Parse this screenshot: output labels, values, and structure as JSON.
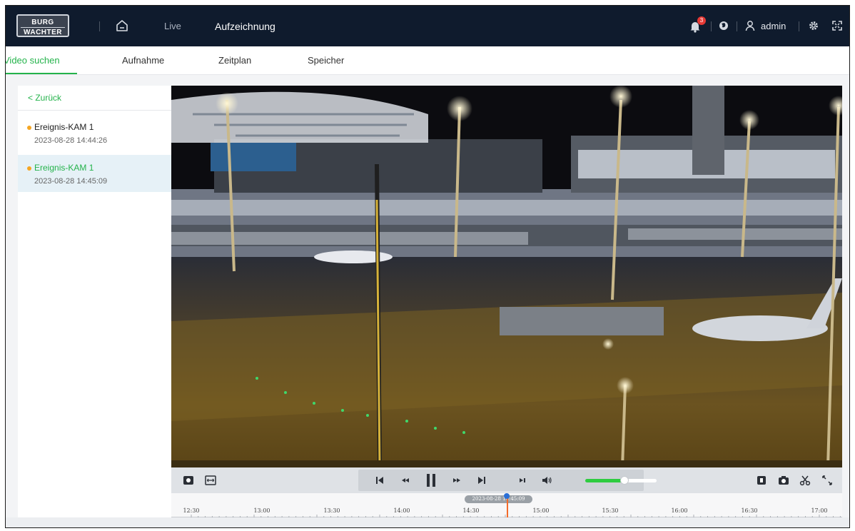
{
  "header": {
    "logo_line1": "BURG",
    "logo_line2": "WACHTER",
    "nav_live": "Live",
    "nav_recording": "Aufzeichnung",
    "notification_count": "3",
    "username": "admin"
  },
  "tabs": [
    {
      "label": "Video suchen",
      "active": true
    },
    {
      "label": "Aufnahme",
      "active": false
    },
    {
      "label": "Zeitplan",
      "active": false
    },
    {
      "label": "Speicher",
      "active": false
    }
  ],
  "sidebar": {
    "back_label": "< Zurück",
    "events": [
      {
        "name": "Ereignis-KAM 1",
        "time": "2023-08-28 14:44:26",
        "selected": false
      },
      {
        "name": "Ereignis-KAM 1",
        "time": "2023-08-28 14:45:09",
        "selected": true
      }
    ]
  },
  "player": {
    "state": "playing",
    "volume": 0.55
  },
  "timeline": {
    "labels": [
      "12:30",
      "13:00",
      "13:30",
      "14:00",
      "14:30",
      "15:00",
      "15:30",
      "16:00",
      "16:30",
      "17:00"
    ],
    "current_time": "2023-08-28 14:45:09"
  },
  "colors": {
    "accent": "#24b34b",
    "header_bg": "#0f1b2d",
    "event_dot": "#f5a623",
    "badge": "#e53935",
    "timeline_cursor": "#f36b2a"
  }
}
